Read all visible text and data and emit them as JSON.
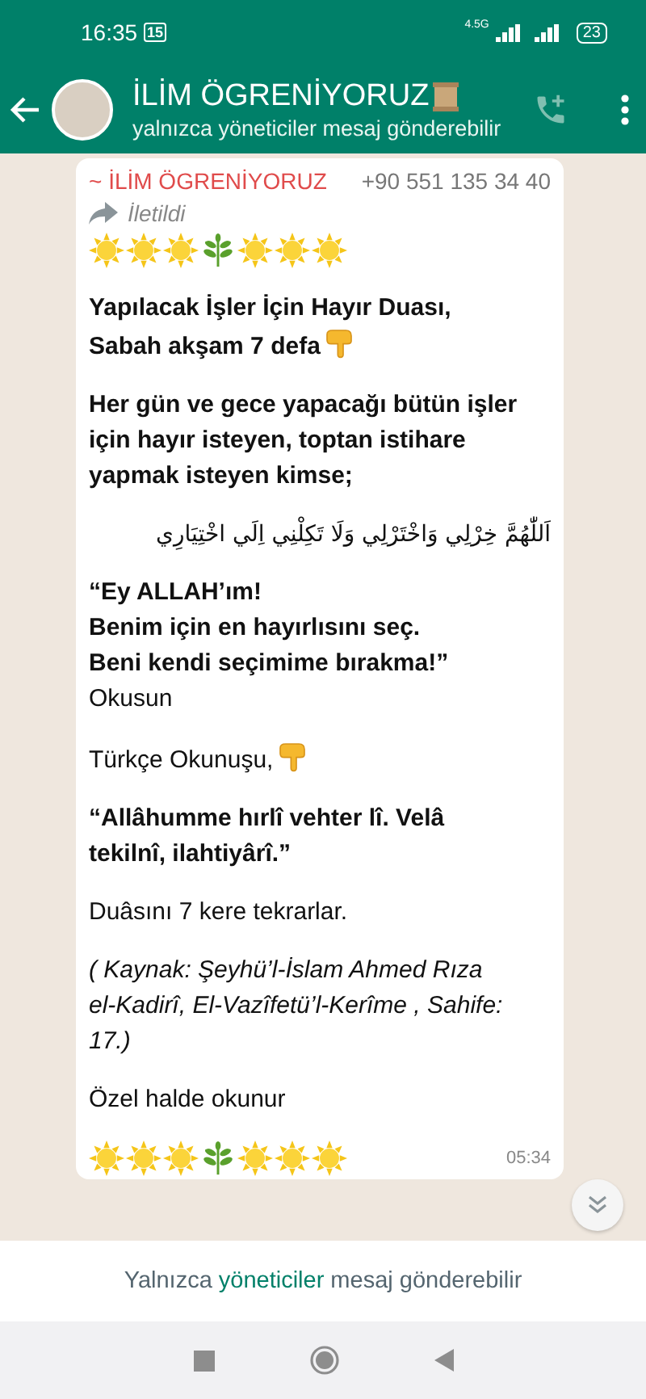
{
  "status_bar": {
    "time": "16:35",
    "calendar_badge": "15",
    "network": "4.5G",
    "battery": "23"
  },
  "header": {
    "title": "İLİM ÖGRENİYORUZ",
    "subtitle": "yalnızca yöneticiler mesaj gönderebilir"
  },
  "message": {
    "sender": "~ İLİM ÖGRENİYORUZ",
    "phone": "+90 551 135 34 40",
    "forwarded_label": "İletildi",
    "time": "05:34",
    "blocks": [
      {
        "kind": "emoji_row"
      },
      {
        "kind": "bold",
        "text": "Yapılacak İşler İçin Hayır Duası,\nSabah akşam 7 defa",
        "pointer": true
      },
      {
        "kind": "bold",
        "text": "Her gün ve gece yapacağı bütün işler\niçin  hayır isteyen, toptan istihare\nyapmak isteyen kimse;",
        "pointer": false
      },
      {
        "kind": "arabic",
        "text": "اَللّٰهُمَّ خِرْلِي وَاخْتَرْلِي وَلَا تَكِلْنِي اِلَي اخْتِيَارِي"
      },
      {
        "kind": "plain",
        "text": "**“Ey ALLAH’ım!\nBenim için en hayırlısını seç.\nBeni kendi seçimime bırakma!”**\nOkusun",
        "pointer": false
      },
      {
        "kind": "plain",
        "text": "Türkçe Okunuşu,",
        "pointer": true
      },
      {
        "kind": "bold",
        "text": " “Allâhumme hırlî vehter lî. Velâ\ntekilnî, ilahtiyârî.”",
        "pointer": false
      },
      {
        "kind": "plain",
        "text": "Duâsını 7 kere tekrarlar.",
        "pointer": false
      },
      {
        "kind": "italic",
        "text": " ( Kaynak: Şeyhü’l-İslam Ahmed Rıza\nel-Kadirî, El-Vazîfetü’l-Kerîme , Sahife:\n17.)",
        "pointer": false
      },
      {
        "kind": "plain",
        "text": "Özel halde okunur",
        "pointer": false
      },
      {
        "kind": "emoji_row"
      }
    ]
  },
  "footer": {
    "prefix": "Yalnızca",
    "link": "yöneticiler",
    "suffix": "mesaj gönderebilir"
  }
}
